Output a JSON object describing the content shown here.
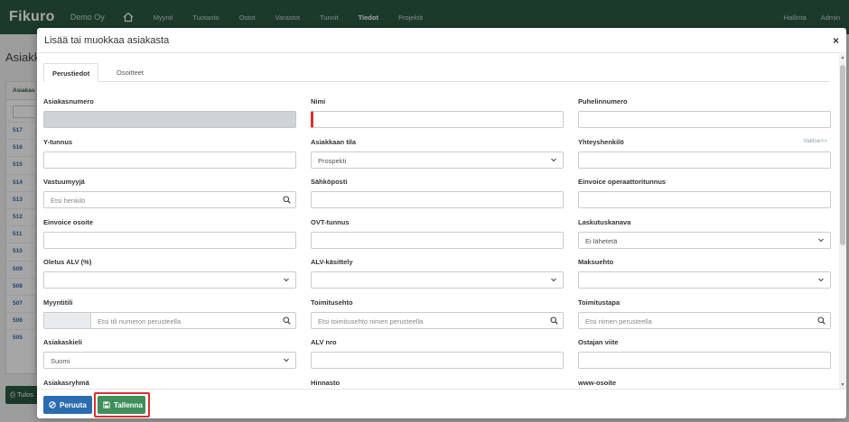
{
  "nav": {
    "brand": "Fikuro",
    "company": "Demo Oy",
    "items": [
      "Myynti",
      "Tuotanto",
      "Ostot",
      "Varastot",
      "Tunnit",
      "Tiedot",
      "Projektit"
    ],
    "active_index": 5,
    "right": [
      "Hallinta",
      "Admin"
    ]
  },
  "background": {
    "title": "Asiakk",
    "column_header": "Asiakas",
    "rows": [
      "517",
      "516",
      "515",
      "514",
      "513",
      "512",
      "511",
      "510",
      "509",
      "508",
      "507",
      "506",
      "505"
    ],
    "button_label": "Tulos"
  },
  "modal": {
    "title": "Lisää tai muokkaa asiakasta",
    "close": "×",
    "tabs": [
      {
        "label": "Perustiedot",
        "active": true
      },
      {
        "label": "Osoitteet",
        "active": false
      }
    ],
    "fields": {
      "asiakasnumero": {
        "label": "Asiakasnumero",
        "value": ""
      },
      "nimi": {
        "label": "Nimi",
        "value": ""
      },
      "puhelinnumero": {
        "label": "Puhelinnumero",
        "value": ""
      },
      "y_tunnus": {
        "label": "Y-tunnus",
        "value": ""
      },
      "asiakkaan_tila": {
        "label": "Asiakkaan tila",
        "value": "Prospekti"
      },
      "yhteyshenkilo": {
        "label": "Yhteyshenkilö",
        "value": "",
        "link": "Valitse>>"
      },
      "vastuumyyja": {
        "label": "Vastuumyyjä",
        "placeholder": "Etsi henkilö"
      },
      "sahkoposti": {
        "label": "Sähköposti",
        "value": ""
      },
      "einvoice_operaattori": {
        "label": "Einvoice operaattoritunnus",
        "value": ""
      },
      "einvoice_osoite": {
        "label": "Einvoice osoite",
        "value": ""
      },
      "ovt_tunnus": {
        "label": "OVT-tunnus",
        "value": ""
      },
      "laskutuskanava": {
        "label": "Laskutuskanava",
        "value": "Ei lähetetä"
      },
      "oletus_alv": {
        "label": "Oletus ALV (%)",
        "value": ""
      },
      "alv_kasittely": {
        "label": "ALV-käsittely",
        "value": ""
      },
      "maksuehto": {
        "label": "Maksuehto",
        "value": ""
      },
      "myyntitili": {
        "label": "Myyntitili",
        "placeholder": "Etsi tili numeron perusteella"
      },
      "toimitusehto": {
        "label": "Toimitusehto",
        "placeholder": "Etsi toimitusehto nimen perusteella"
      },
      "toimitustapa": {
        "label": "Toimitustapa",
        "placeholder": "Etsi nimen perusteella"
      },
      "asiakaskieli": {
        "label": "Asiakaskieli",
        "value": "Suomi"
      },
      "alv_nro": {
        "label": "ALV nro",
        "value": ""
      },
      "ostajan_viite": {
        "label": "Ostajan viite",
        "value": ""
      },
      "asiakasryhma": {
        "label": "Asiakasryhmä"
      },
      "hinnasto": {
        "label": "Hinnasto"
      },
      "www_osoite": {
        "label": "www-osoite"
      }
    },
    "footer": {
      "cancel_label": "Peruuta",
      "save_label": "Tallenna"
    }
  },
  "colors": {
    "nav_bg": "#2b5a3f",
    "primary_blue": "#2b6cb0",
    "save_green": "#3f8f5a",
    "required_red": "#d9302c",
    "highlight_red": "#d9302c"
  },
  "icons": [
    "home-icon",
    "search-icon",
    "chevron-down-icon",
    "ban-icon",
    "save-icon",
    "close-icon",
    "print-icon"
  ]
}
